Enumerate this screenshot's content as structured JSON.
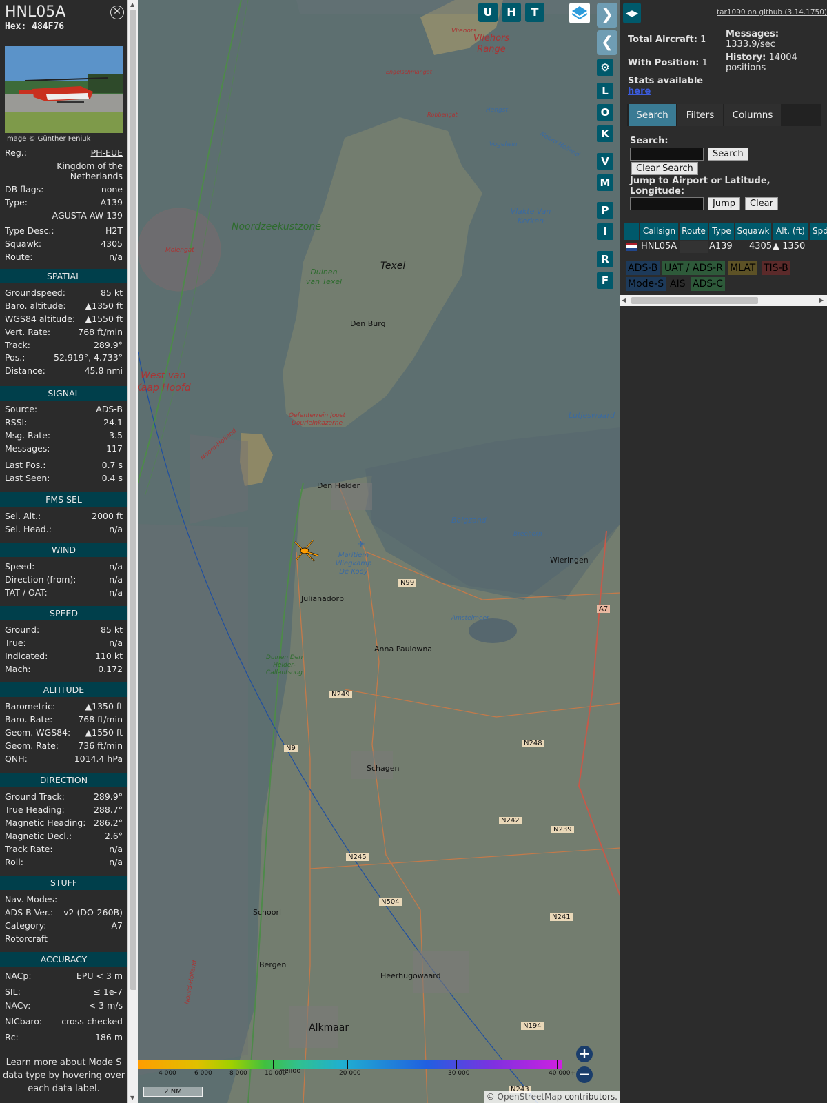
{
  "left": {
    "ident": "HNL05A",
    "hex": "Hex: 484F76",
    "photo_credit": "Image © Günther Feniuk",
    "details": [
      {
        "k": "Reg.:",
        "v": "PH-EUE"
      },
      {
        "k": "",
        "v": "Kingdom of the"
      },
      {
        "k": "",
        "v": "Netherlands"
      },
      {
        "k": "DB flags:",
        "v": "none"
      },
      {
        "k": "Type:",
        "v": "A139"
      },
      {
        "k": "",
        "v": "AGUSTA AW-139"
      },
      {
        "k": "Type Desc.:",
        "v": "H2T"
      },
      {
        "k": "Squawk:",
        "v": "4305"
      },
      {
        "k": "Route:",
        "v": "n/a"
      }
    ],
    "sections": {
      "spatial": "SPATIAL",
      "signal": "SIGNAL",
      "fms": "FMS SEL",
      "wind": "WIND",
      "speed": "SPEED",
      "altitude": "ALTITUDE",
      "direction": "DIRECTION",
      "stuff": "STUFF",
      "accuracy": "ACCURACY"
    },
    "spatial": [
      {
        "k": "Groundspeed:",
        "v": "85 kt"
      },
      {
        "k": "Baro. altitude:",
        "v": "▲1350 ft"
      },
      {
        "k": "WGS84 altitude:",
        "v": "▲1550 ft"
      },
      {
        "k": "Vert. Rate:",
        "v": "768 ft/min"
      },
      {
        "k": "Track:",
        "v": "289.9°"
      },
      {
        "k": "Pos.:",
        "v": "52.919°, 4.733°"
      },
      {
        "k": "Distance:",
        "v": "45.8 nmi"
      }
    ],
    "signal": [
      {
        "k": "Source:",
        "v": "ADS-B"
      },
      {
        "k": "RSSI:",
        "v": "-24.1"
      },
      {
        "k": "Msg. Rate:",
        "v": "3.5"
      },
      {
        "k": "Messages:",
        "v": "117"
      },
      {
        "k": "Last Pos.:",
        "v": "0.7 s"
      },
      {
        "k": "Last Seen:",
        "v": "0.4 s"
      }
    ],
    "fms": [
      {
        "k": "Sel. Alt.:",
        "v": "2000 ft"
      },
      {
        "k": "Sel. Head.:",
        "v": "n/a"
      }
    ],
    "wind": [
      {
        "k": "Speed:",
        "v": "n/a"
      },
      {
        "k": "Direction (from):",
        "v": "n/a"
      },
      {
        "k": "TAT / OAT:",
        "v": "n/a"
      }
    ],
    "speed": [
      {
        "k": "Ground:",
        "v": "85 kt"
      },
      {
        "k": "True:",
        "v": "n/a"
      },
      {
        "k": "Indicated:",
        "v": "110 kt"
      },
      {
        "k": "Mach:",
        "v": "0.172"
      }
    ],
    "altitude": [
      {
        "k": "Barometric:",
        "v": "▲1350 ft"
      },
      {
        "k": "Baro. Rate:",
        "v": "768 ft/min"
      },
      {
        "k": "Geom. WGS84:",
        "v": "▲1550 ft"
      },
      {
        "k": "Geom. Rate:",
        "v": "736 ft/min"
      },
      {
        "k": "QNH:",
        "v": "1014.4 hPa"
      }
    ],
    "direction": [
      {
        "k": "Ground Track:",
        "v": "289.9°"
      },
      {
        "k": "True Heading:",
        "v": "288.7°"
      },
      {
        "k": "Magnetic Heading:",
        "v": "286.2°"
      },
      {
        "k": "Magnetic Decl.:",
        "v": "2.6°"
      },
      {
        "k": "Track Rate:",
        "v": "n/a"
      },
      {
        "k": "Roll:",
        "v": "n/a"
      }
    ],
    "stuff": [
      {
        "k": "Nav. Modes:",
        "v": ""
      },
      {
        "k": "ADS-B Ver.:",
        "v": "v2 (DO-260B)"
      },
      {
        "k": "Category:",
        "v": "A7"
      },
      {
        "k": "Rotorcraft",
        "v": ""
      }
    ],
    "accuracy": [
      {
        "k": "NACp:",
        "v": "EPU < 3 m"
      },
      {
        "k": "SIL:",
        "v": "≤ 1e-7"
      },
      {
        "k": "NACv:",
        "v": "< 3 m/s"
      },
      {
        "k": "NICbaro:",
        "v": "cross-checked"
      },
      {
        "k": "Rc:",
        "v": "186 m"
      }
    ],
    "learn_more": "Learn more about Mode S data type by hovering over each data label."
  },
  "map": {
    "top_buttons": [
      "U",
      "H",
      "T"
    ],
    "side_buttons": [
      "L",
      "O",
      "K",
      "V",
      "M",
      "P",
      "I",
      "R",
      "F"
    ],
    "labels": {
      "vliehors": "Vliehors",
      "vliehors_range": "Vliehors Range",
      "engelschmangat": "Engelschmangat",
      "robbengat": "Robbengat",
      "hengst": "Hengst",
      "vogelwin": "Vogelwin",
      "noord_holland_n": "Noord Holland",
      "vlakte": "Vlakte Van Kerken",
      "noordzeekustzone": "Noordzeekustzone",
      "molengat": "Molengat",
      "texel": "Texel",
      "duinen_texel": "Duinen van Texel",
      "den_burg": "Den Burg",
      "west_van": "West van",
      "kaap_hoofd": "Kaap Hoofd",
      "oefenterrein": "Oefenterrein Joost Dourleinkazerne",
      "lutjeswaard": "Lutjeswaard",
      "den_helder": "Den Helder",
      "balgzand": "Balgzand",
      "breehorn": "Breehorn",
      "wieringen": "Wieringen",
      "maritiem": "Maritiem Vliegkamp De Kooy",
      "n99": "N99",
      "julianadorp": "Julianadorp",
      "amstelmeer": "Amstelmeer",
      "a7": "A7",
      "anna_paulowna": "Anna Paulowna",
      "duinen_den_helder": "Duinen Den Helder-Callantsoog",
      "n249": "N249",
      "n248": "N248",
      "n9": "N9",
      "schagen": "Schagen",
      "n242": "N242",
      "n239": "N239",
      "n245": "N245",
      "n504": "N504",
      "schoorl": "Schoorl",
      "n241": "N241",
      "bergen": "Bergen",
      "heerhugowaard": "Heerhugowaard",
      "alkmaar": "Alkmaar",
      "n194": "N194",
      "heiloo": "Heiloo",
      "n243": "N243",
      "noord_holland_w": "Noord-Holland",
      "noord_holland_sw": "Noord-Holland"
    },
    "altitude_scale": [
      "4 000",
      "6 000",
      "8 000",
      "10 000",
      "20 000",
      "30 000",
      "40 000+"
    ],
    "scale_bar": "2 NM",
    "attribution_prefix": "©",
    "attribution_link": "OpenStreetMap",
    "attribution_suffix": "contributors.",
    "zoom_in": "+",
    "zoom_out": "−"
  },
  "right": {
    "github_link": "tar1090 on github (3.14.1750)",
    "total_aircraft_label": "Total Aircraft:",
    "total_aircraft": "1",
    "with_position_label": "With Position:",
    "with_position": "1",
    "messages_label": "Messages:",
    "messages_rate": "1333.9/sec",
    "history_label": "History:",
    "history_value": "14004",
    "history_unit": "positions",
    "stats_label": "Stats available",
    "stats_link": "here",
    "tabs": [
      "Search",
      "Filters",
      "Columns"
    ],
    "search_label": "Search:",
    "search_button": "Search",
    "clear_search_button": "Clear Search",
    "jump_label": "Jump to Airport or Latitude, Longitude:",
    "jump_button": "Jump",
    "clear_button": "Clear",
    "table_headers": [
      "Callsign",
      "Route",
      "Type",
      "Squawk",
      "Alt. (ft)",
      "Spd"
    ],
    "table_row": {
      "callsign": "HNL05A",
      "route": "",
      "type": "A139",
      "squawk": "4305",
      "alt": "▲ 1350"
    },
    "legend": [
      "ADS-B",
      "UAT / ADS-R",
      "MLAT",
      "TIS-B",
      "Mode-S",
      "AIS",
      "ADS-C"
    ],
    "colors": {
      "adsb": "#1d3a5a",
      "uat": "#2e5a3a",
      "mlat": "#5d5226",
      "tisb": "#5b2a2a",
      "modes": "#1d3a5a",
      "adsc": "#2e5a3a",
      "header": "#00596b"
    }
  }
}
